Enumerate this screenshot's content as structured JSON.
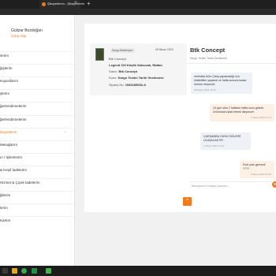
{
  "browser": {
    "tab_title": "Şikayetlerim - Şikayetlerim",
    "close_glyph": "×",
    "new_tab_glyph": "+"
  },
  "sidebar": {
    "profile_name": "Gülizar Bozdoğan",
    "logout": "Çıkış Yap",
    "items": [
      {
        "label": "ılerim"
      },
      {
        "label": "ğişlerim"
      },
      {
        "label": "Kuponlarım"
      },
      {
        "label": "şlerim"
      },
      {
        "label": "ğerlendirmelerim"
      },
      {
        "label": "ğerlendirmelerim"
      },
      {
        "label": "ikayetlerim",
        "chevron": "›"
      },
      {
        "label": "Mesajlarım"
      },
      {
        "label": "ın / İşlemlerim"
      },
      {
        "label": "& Keşif İadelerim"
      },
      {
        "label": "Hizmet & Çiçek İadelerim"
      },
      {
        "label": "ğilerim"
      },
      {
        "label": "lerim"
      },
      {
        "label": "Kartım"
      }
    ]
  },
  "order": {
    "badge": "Kargo Bekleniyor",
    "date": "28 Nisan 2023",
    "seller": "Btk Concept",
    "product": "Legend Cilt Köşlik Saksıcak, Rattan",
    "seller_label": "Satıcı:",
    "seller_value": "Btk Concept",
    "subject_label": "Konu:",
    "subject_value": "Kargo Teslim Tarihi Gecikmesi",
    "order_no_label": "Sipariş No:",
    "order_no_value": "1069185052-A"
  },
  "chat": {
    "title": "Btk Concept",
    "subtitle": "Kargo Teslim Tarihi Gecikmesi",
    "messages": [
      {
        "dir": "in",
        "text": "merhaba ürün Çalış yapamadığı için ekisiklikler yaşandı ve hafta sonuna kadar ürünün eleşecek",
        "time": "28 Nisan 2023 16:30"
      },
      {
        "dir": "out",
        "text": "10 gün oldu 2 haftadır hafta sonu gelcek. Ürününüzü iptal etmek istiyorum!",
        "time": "1 Mayıs 2023 11:14"
      },
      {
        "dir": "in",
        "text": "ÇARŞAMBA GÜNÜ SİZLERE ULAŞACAKTIR",
        "time": "1 Mayıs 2023 11:32"
      },
      {
        "dir": "out",
        "text": "Evet yine gelmedi ????",
        "time": "4 Mayıs 2023 13:30"
      }
    ],
    "input_placeholder": "Mesajınızı buraya yazınız...",
    "send_glyph": "➤"
  },
  "scroll_top_glyph": "^",
  "colors": {
    "accent": "#f27a1a"
  }
}
